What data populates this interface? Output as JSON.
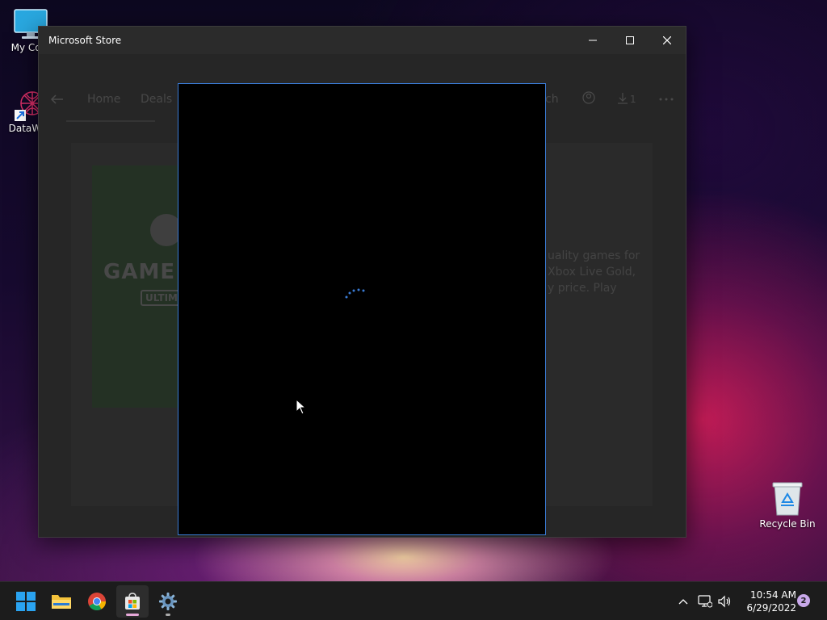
{
  "desktop": {
    "icons": [
      {
        "label": "My Com",
        "icon": "computer-icon"
      },
      {
        "label": "DataWag",
        "icon": "datawag-icon"
      },
      {
        "label": "Recycle Bin",
        "icon": "recycle-bin-icon"
      }
    ]
  },
  "window": {
    "title": "Microsoft Store",
    "controls": {
      "minimize": "minimize-icon",
      "maximize": "maximize-icon",
      "close": "close-icon"
    }
  },
  "store": {
    "nav": {
      "home": "Home",
      "deals": "Deals",
      "search_partial": "ch",
      "downloads_count": "1"
    },
    "hero": {
      "title": "GAME",
      "subtitle": "ULTIM"
    },
    "description_lines": [
      "uality games for",
      "Xbox Live Gold,",
      "y price. Play"
    ]
  },
  "overlay": {
    "state": "loading",
    "accent": "#3a7bd5"
  },
  "taskbar": {
    "apps": [
      {
        "name": "start",
        "icon": "windows-start-icon"
      },
      {
        "name": "file-explorer",
        "icon": "folder-icon"
      },
      {
        "name": "chrome",
        "icon": "chrome-icon"
      },
      {
        "name": "microsoft-store",
        "icon": "store-icon",
        "active": true
      },
      {
        "name": "settings",
        "icon": "gear-icon"
      }
    ],
    "tray": {
      "time": "10:54 AM",
      "date": "6/29/2022",
      "notifications": "2"
    }
  },
  "colors": {
    "accent": "#3a7bd5",
    "taskbar_bg": "#1c1c1c",
    "window_bg": "#2b2b2b"
  }
}
